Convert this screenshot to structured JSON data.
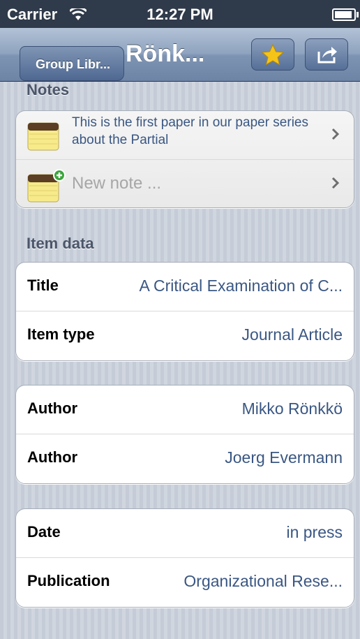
{
  "status_bar": {
    "carrier": "Carrier",
    "time": "12:27 PM"
  },
  "nav": {
    "back_label": "Group Libr...",
    "title": "Rönk..."
  },
  "notes": {
    "header": "Notes",
    "items": [
      {
        "text": "This is the first paper in our paper series about the Partial"
      }
    ],
    "new_note_placeholder": "New note ..."
  },
  "item_data": {
    "header": "Item data",
    "group1": [
      {
        "label": "Title",
        "value": "A Critical Examination of C..."
      },
      {
        "label": "Item type",
        "value": "Journal Article"
      }
    ],
    "group2": [
      {
        "label": "Author",
        "value": "Mikko Rönkkö"
      },
      {
        "label": "Author",
        "value": "Joerg Evermann"
      }
    ],
    "group3": [
      {
        "label": "Date",
        "value": "in press"
      },
      {
        "label": "Publication",
        "value": "Organizational Rese..."
      }
    ]
  },
  "colors": {
    "accent": "#3a5783",
    "navbar": "#7e94b3",
    "star": "#f5c419"
  },
  "icons": [
    "wifi-icon",
    "battery-icon",
    "star-icon",
    "share-icon",
    "notepad-icon",
    "add-badge-icon",
    "chevron-right-icon"
  ]
}
